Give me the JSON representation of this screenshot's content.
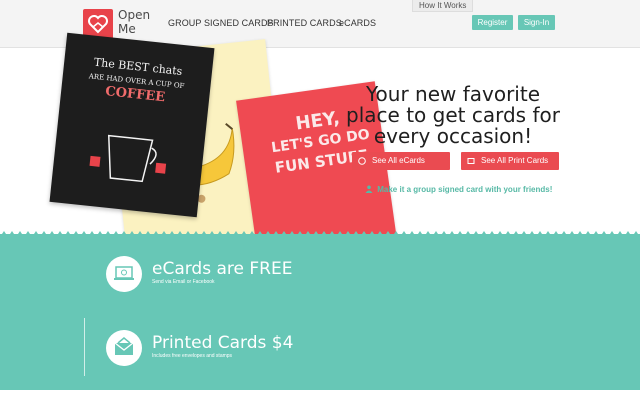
{
  "header": {
    "logo_text": "Open Me",
    "nav": [
      "GROUP SIGNED CARDS",
      "PRINTED CARDS",
      "eCARDS"
    ],
    "how_it_works": "How It Works",
    "register": "Register",
    "sign_in": "Sign-In"
  },
  "hero": {
    "headline": "Your new favorite place to get cards for every occasion!",
    "btn_ecards": "See All eCards",
    "btn_print": "See All Print Cards",
    "group_signed": "Make it a group signed card with your friends!",
    "card_black_text": [
      "The BEST chats",
      "ARE HAD OVER A CUP OF",
      "COFFEE"
    ],
    "card_red_text": [
      "HEY,",
      "LET'S GO DO",
      "FUN STUFF."
    ]
  },
  "features": [
    {
      "title": "eCards are FREE",
      "subtitle": "Send via Email or Facebook"
    },
    {
      "title": "Printed Cards $4",
      "subtitle": "Includes free envelopes and stamps"
    }
  ],
  "colors": {
    "accent_teal": "#67c7b6",
    "accent_red": "#e8434a"
  }
}
